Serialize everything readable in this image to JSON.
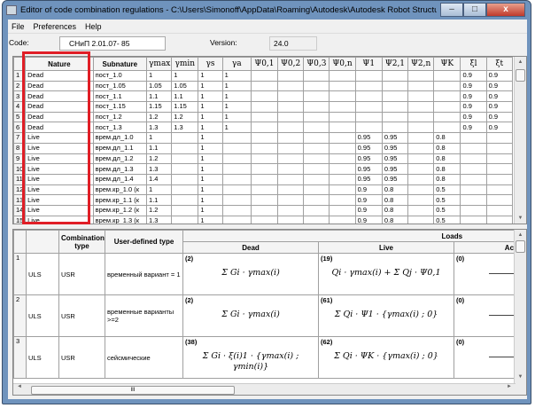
{
  "window": {
    "title": "Editor of code combination regulations - C:\\Users\\Simonoff\\AppData\\Roaming\\Autodesk\\Autodesk Robot Structural Analys...",
    "minimize": "–",
    "maximize": "□",
    "close": "x"
  },
  "menu": [
    {
      "label": "File"
    },
    {
      "label": "Preferences"
    },
    {
      "label": "Help"
    }
  ],
  "code": {
    "label": "Code:",
    "value": "СНиП 2.01.07- 85"
  },
  "version": {
    "label": "Version:",
    "value": "24.0"
  },
  "natures_table": {
    "headers": [
      "",
      "Nature",
      "Subnature",
      "γmax",
      "γmin",
      "γs",
      "γa",
      "Ψ0,1",
      "Ψ0,2",
      "Ψ0,3",
      "Ψ0,n",
      "Ψ1",
      "Ψ2,1",
      "Ψ2,n",
      "ΨK",
      "ξl",
      "ξt"
    ],
    "rows": [
      [
        "1",
        "Dead",
        "пост_1.0",
        "1",
        "1",
        "1",
        "1",
        "",
        "",
        "",
        "",
        "",
        "",
        "",
        "",
        "0.9",
        "0.9"
      ],
      [
        "2",
        "Dead",
        "пост_1.05",
        "1.05",
        "1.05",
        "1",
        "1",
        "",
        "",
        "",
        "",
        "",
        "",
        "",
        "",
        "0.9",
        "0.9"
      ],
      [
        "3",
        "Dead",
        "пост_1.1",
        "1.1",
        "1.1",
        "1",
        "1",
        "",
        "",
        "",
        "",
        "",
        "",
        "",
        "",
        "0.9",
        "0.9"
      ],
      [
        "4",
        "Dead",
        "пост_1.15",
        "1.15",
        "1.15",
        "1",
        "1",
        "",
        "",
        "",
        "",
        "",
        "",
        "",
        "",
        "0.9",
        "0.9"
      ],
      [
        "5",
        "Dead",
        "пост_1.2",
        "1.2",
        "1.2",
        "1",
        "1",
        "",
        "",
        "",
        "",
        "",
        "",
        "",
        "",
        "0.9",
        "0.9"
      ],
      [
        "6",
        "Dead",
        "пост_1.3",
        "1.3",
        "1.3",
        "1",
        "1",
        "",
        "",
        "",
        "",
        "",
        "",
        "",
        "",
        "0.9",
        "0.9"
      ],
      [
        "7",
        "Live",
        "врем.дл_1.0",
        "1",
        "",
        "1",
        "",
        "",
        "",
        "",
        "",
        "0.95",
        "0.95",
        "",
        "0.8",
        "",
        ""
      ],
      [
        "8",
        "Live",
        "врем.дл_1.1",
        "1.1",
        "",
        "1",
        "",
        "",
        "",
        "",
        "",
        "0.95",
        "0.95",
        "",
        "0.8",
        "",
        ""
      ],
      [
        "9",
        "Live",
        "врем.дл_1.2",
        "1.2",
        "",
        "1",
        "",
        "",
        "",
        "",
        "",
        "0.95",
        "0.95",
        "",
        "0.8",
        "",
        ""
      ],
      [
        "10",
        "Live",
        "врем.дл_1.3",
        "1.3",
        "",
        "1",
        "",
        "",
        "",
        "",
        "",
        "0.95",
        "0.95",
        "",
        "0.8",
        "",
        ""
      ],
      [
        "11",
        "Live",
        "врем.дл_1.4",
        "1.4",
        "",
        "1",
        "",
        "",
        "",
        "",
        "",
        "0.95",
        "0.95",
        "",
        "0.8",
        "",
        ""
      ],
      [
        "12",
        "Live",
        "врем.кр_1.0 (к",
        "1",
        "",
        "1",
        "",
        "",
        "",
        "",
        "",
        "0.9",
        "0.8",
        "",
        "0.5",
        "",
        ""
      ],
      [
        "13",
        "Live",
        "врем.кр_1.1 (к",
        "1.1",
        "",
        "1",
        "",
        "",
        "",
        "",
        "",
        "0.9",
        "0.8",
        "",
        "0.5",
        "",
        ""
      ],
      [
        "14",
        "Live",
        "врем.кр_1.2 (к",
        "1.2",
        "",
        "1",
        "",
        "",
        "",
        "",
        "",
        "0.9",
        "0.8",
        "",
        "0.5",
        "",
        ""
      ],
      [
        "15",
        "Live",
        "врем.кр_1.3 (к",
        "1.3",
        "",
        "1",
        "",
        "",
        "",
        "",
        "",
        "0.9",
        "0.8",
        "",
        "0.5",
        "",
        ""
      ]
    ]
  },
  "combinations_table": {
    "headers": {
      "combination_type": "Combination type",
      "user_defined_type": "User-defined type",
      "loads": "Loads",
      "dead": "Dead",
      "live": "Live",
      "accidental": "Ac"
    },
    "rows": [
      {
        "n": "1",
        "limit": "ULS",
        "type": "USR",
        "user_type": "временный вариант = 1",
        "dead_id": "(2)",
        "dead_formula": "Σ Gi · γmax(i)",
        "live_id": "(19)",
        "live_formula": "Qi · γmax(i) + Σ Qj · Ψ0,1",
        "acc_id": "(0)"
      },
      {
        "n": "2",
        "limit": "ULS",
        "type": "USR",
        "user_type": "временные варианты >=2",
        "dead_id": "(2)",
        "dead_formula": "Σ Gi · γmax(i)",
        "live_id": "(61)",
        "live_formula": "Σ Qi · Ψ1 · {γmax(i) ; 0}",
        "acc_id": "(0)"
      },
      {
        "n": "3",
        "limit": "ULS",
        "type": "USR",
        "user_type": "сейсмические",
        "dead_id": "(38)",
        "dead_formula": "Σ Gi · ξ(i)1 · {γmax(i) ; γmin(i)}",
        "live_id": "(62)",
        "live_formula": "Σ Qi · ΨK · {γmax(i) ; 0}",
        "acc_id": "(0)"
      }
    ]
  },
  "hscroll_grip": "III"
}
